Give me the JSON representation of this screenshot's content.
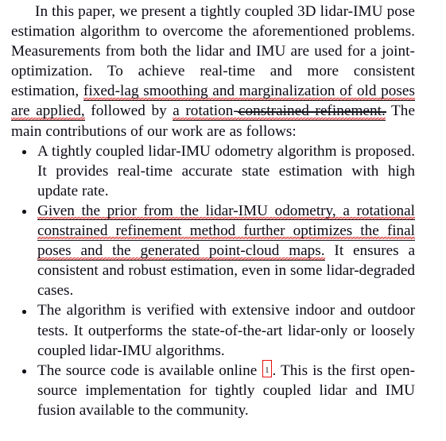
{
  "document": {
    "kind": "academic-paper-column",
    "intro_paragraph": {
      "indent_text": "In this paper, we present a tightly coupled 3D lidar-IMU pose estimation algorithm to overcome the aforementioned problems. Measurements from both the lidar and IMU are used for a joint-optimization. To achieve real-time and more consistent estimation, ",
      "edited_underlined_1": "fixed-lag smoothing and marginalization of old poses are applied,",
      "mid_text": " followed by ",
      "edited_underlined_2": "a rotation-",
      "edited_struck": "constrained refinement.",
      "tail_text": " The main contributions of our work are as follows:"
    },
    "bullets": [
      {
        "marker": "bullet",
        "plain_text": "A tightly coupled lidar-IMU odometry algorithm is proposed. It provides real-time accurate state estimation with high update rate."
      },
      {
        "marker": "bullet",
        "edited_underlined": "Given the prior from the lidar-IMU odometry, a rotational constrained refinement method further optimizes the final poses and the generated point-cloud maps.",
        "plain_text": " It ensures a consistent and robust estimation, even in some lidar-degraded cases."
      },
      {
        "marker": "bullet",
        "plain_text": "The algorithm is verified with extensive indoor and outdoor tests. It outperforms the state-of-the-art lidar-only or loosely coupled lidar-IMU algorithms."
      },
      {
        "marker": "bullet",
        "lead_text": "The source code is available online ",
        "citation_marker": "1",
        "tail_text": ". This is the first open-source implementation for tightly coupled lidar and IMU fusion available to the community."
      }
    ]
  },
  "colors": {
    "text": "#0b0b16",
    "spellcheck_squiggle": "#d21c1c",
    "citation_box_border": "#e81010",
    "edit_underline": "#14141c",
    "page_background": "#ffffff"
  }
}
